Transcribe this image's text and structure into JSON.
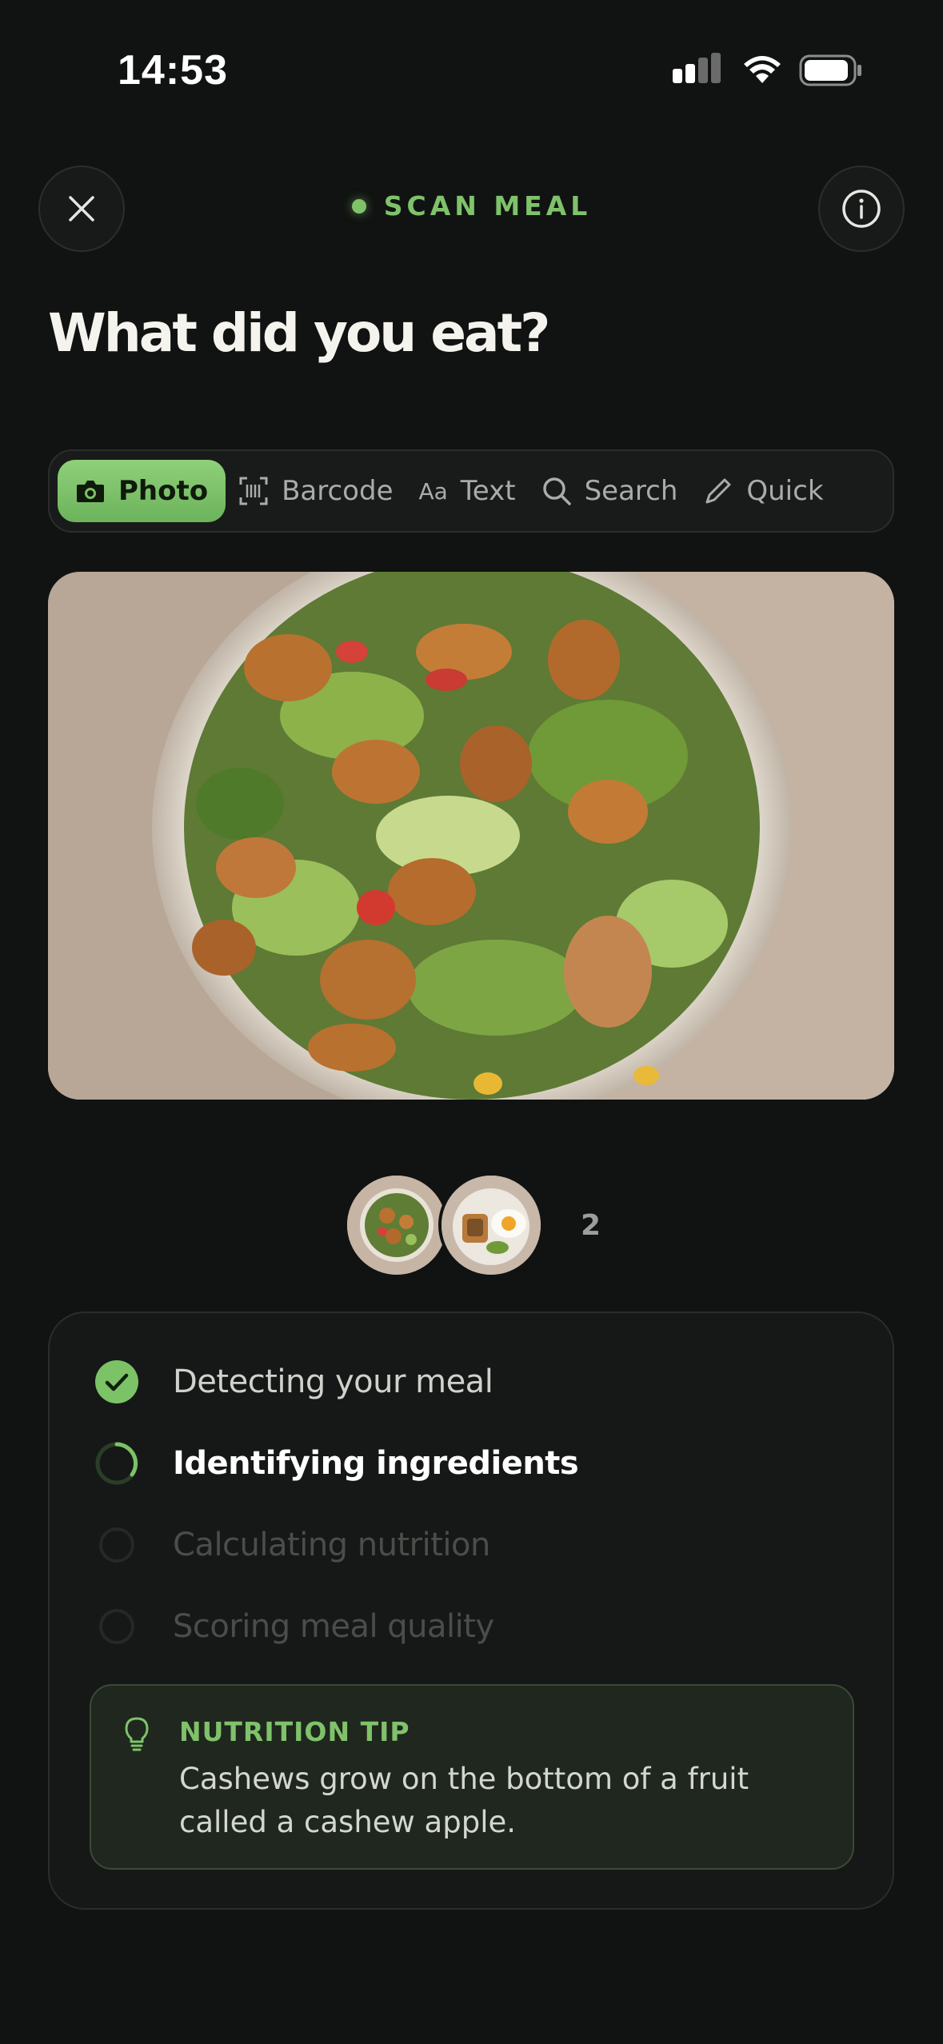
{
  "status_bar": {
    "time": "14:53"
  },
  "header": {
    "label": "SCAN MEAL",
    "title": "What did you eat?"
  },
  "tabs": [
    {
      "label": "Photo",
      "icon": "camera-icon",
      "active": true
    },
    {
      "label": "Barcode",
      "icon": "barcode-icon",
      "active": false
    },
    {
      "label": "Text",
      "icon": "aa-text-icon",
      "icon_text": "Aa",
      "active": false
    },
    {
      "label": "Search",
      "icon": "search-icon",
      "active": false
    },
    {
      "label": "Quick",
      "icon": "pencil-icon",
      "active": false
    }
  ],
  "photos": {
    "count": "2"
  },
  "progress": {
    "steps": [
      {
        "label": "Detecting your meal",
        "state": "done"
      },
      {
        "label": "Identifying ingredients",
        "state": "active"
      },
      {
        "label": "Calculating nutrition",
        "state": "pending"
      },
      {
        "label": "Scoring meal quality",
        "state": "pending"
      }
    ]
  },
  "tip": {
    "title": "NUTRITION TIP",
    "body": "Cashews grow on the bottom of a fruit called a cashew apple."
  },
  "colors": {
    "accent": "#7fc26a",
    "background": "#111312",
    "card": "#161817"
  }
}
